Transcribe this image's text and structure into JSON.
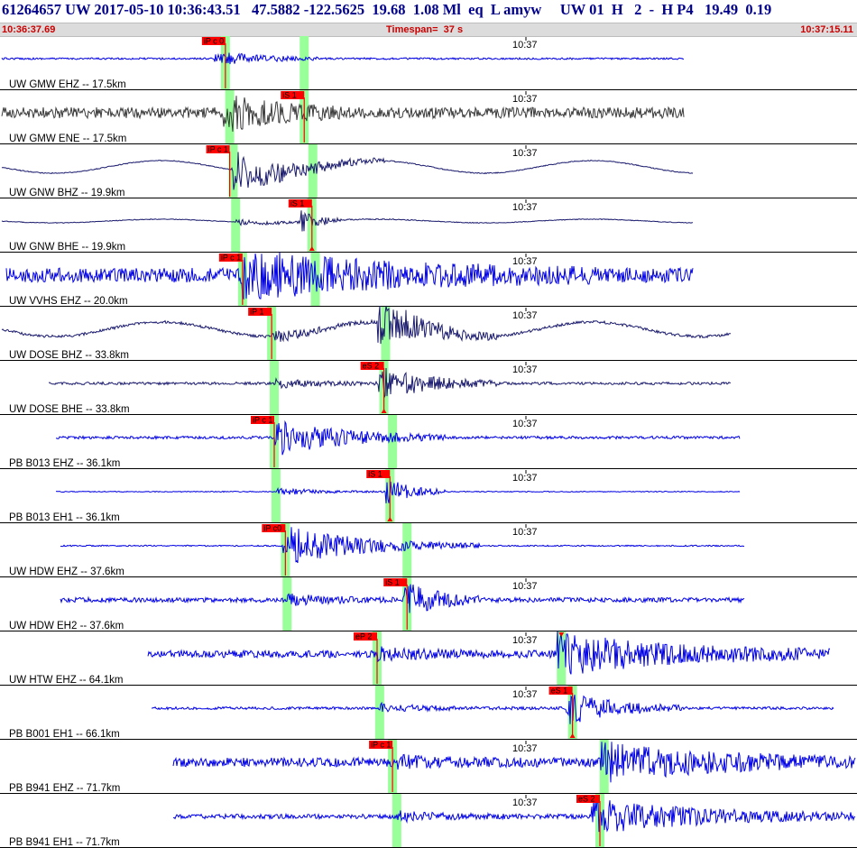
{
  "header": {
    "title": "61264657 UW 2017-05-10 10:36:43.51   47.5882 -122.5625  19.68  1.08 Ml  eq  L amyw     UW 01  H   2  -  H P4   19.49  0.19",
    "start_time": "10:36:37.69",
    "timespan": "Timespan=  37 s",
    "end_time": "10:37:15.11"
  },
  "colors": {
    "trace_blue": "#0000e6",
    "trace_navy": "#1a1a6e",
    "trace_gray": "#3a3a3a",
    "pick_box": "#ff0000",
    "pick_window": "#99ff99",
    "divider": "#000000"
  },
  "panels": [
    {
      "label": "UW GMW EHZ -- 17.5km",
      "tick": "10:37",
      "color": "trace_blue",
      "amp": 6,
      "noise": 1,
      "start": 0.0,
      "end": 0.8,
      "p": 0.263,
      "s": 0.355,
      "pick_label": "iP c 0",
      "pick_at": 0.263,
      "sig": [
        0.25,
        0.38
      ],
      "lf": 0,
      "marker": "none"
    },
    {
      "label": "UW GMW ENE -- 17.5km",
      "tick": "10:37",
      "color": "trace_gray",
      "amp": 14,
      "noise": 6,
      "start": 0.0,
      "end": 0.8,
      "p": 0.268,
      "s": 0.355,
      "pick_label": "iS 1",
      "pick_at": 0.355,
      "sig": [
        0.26,
        0.4
      ],
      "lf": 0,
      "marker": "none"
    },
    {
      "label": "UW GNW BHZ -- 19.9km",
      "tick": "10:37",
      "color": "trace_navy",
      "amp": 18,
      "noise": 0.5,
      "start": 0.0,
      "end": 0.81,
      "p": 0.272,
      "s": 0.365,
      "pick_label": "iP c 1",
      "pick_at": 0.268,
      "sig": [
        0.27,
        0.45
      ],
      "lf": 7,
      "marker": "none"
    },
    {
      "label": "UW GNW BHE -- 19.9km",
      "tick": "10:37",
      "color": "trace_navy",
      "amp": 14,
      "noise": 0.4,
      "start": 0.0,
      "end": 0.81,
      "p": 0.275,
      "s": 0.364,
      "pick_label": "iS 1",
      "pick_at": 0.364,
      "sig": [
        0.35,
        0.4
      ],
      "lf": 2,
      "marker": "s"
    },
    {
      "label": "UW VVHS EHZ -- 20.0km",
      "tick": "10:37",
      "color": "trace_blue",
      "amp": 20,
      "noise": 8,
      "start": 0.005,
      "end": 0.81,
      "p": 0.283,
      "s": 0.368,
      "pick_label": "iP c 1",
      "pick_at": 0.283,
      "sig": [
        0.28,
        0.7
      ],
      "lf": 0,
      "marker": "none"
    },
    {
      "label": "UW DOSE BHZ -- 33.8km",
      "tick": "10:37",
      "color": "trace_navy",
      "amp": 24,
      "noise": 1.5,
      "start": 0.0,
      "end": 0.855,
      "p": 0.317,
      "s": 0.45,
      "pick_label": "iP 1",
      "pick_at": 0.317,
      "sig": [
        0.44,
        0.58
      ],
      "lf": 8,
      "marker": "none"
    },
    {
      "label": "UW DOSE BHE -- 33.8km",
      "tick": "10:37",
      "color": "trace_navy",
      "amp": 18,
      "noise": 1.5,
      "start": 0.055,
      "end": 0.855,
      "p": 0.32,
      "s": 0.448,
      "pick_label": "eS 2",
      "pick_at": 0.448,
      "sig": [
        0.44,
        0.58
      ],
      "lf": 0,
      "marker": "s"
    },
    {
      "label": "PB B013 EHZ -- 36.1km",
      "tick": "10:37",
      "color": "trace_blue",
      "amp": 16,
      "noise": 1.5,
      "start": 0.063,
      "end": 0.865,
      "p": 0.32,
      "s": 0.458,
      "pick_label": "iP c 1",
      "pick_at": 0.32,
      "sig": [
        0.32,
        0.52
      ],
      "lf": 0,
      "marker": "none"
    },
    {
      "label": "PB B013 EH1 -- 36.1km",
      "tick": "10:37",
      "color": "trace_blue",
      "amp": 16,
      "noise": 0.5,
      "start": 0.063,
      "end": 0.865,
      "p": 0.322,
      "s": 0.455,
      "pick_label": "iS 1",
      "pick_at": 0.455,
      "sig": [
        0.45,
        0.52
      ],
      "lf": 0,
      "marker": "s"
    },
    {
      "label": "UW HDW EHZ -- 37.6km",
      "tick": "10:37",
      "color": "trace_blue",
      "amp": 18,
      "noise": 0.7,
      "start": 0.068,
      "end": 0.87,
      "p": 0.333,
      "s": 0.475,
      "pick_label": "iP c0",
      "pick_at": 0.333,
      "sig": [
        0.33,
        0.56
      ],
      "lf": 0,
      "marker": "none"
    },
    {
      "label": "UW HDW EH2 -- 37.6km",
      "tick": "10:37",
      "color": "trace_blue",
      "amp": 20,
      "noise": 2.5,
      "start": 0.068,
      "end": 0.87,
      "p": 0.335,
      "s": 0.475,
      "pick_label": "iS 1",
      "pick_at": 0.475,
      "sig": [
        0.47,
        0.56
      ],
      "lf": 0,
      "marker": "none"
    },
    {
      "label": "UW HTW EHZ -- 64.1km",
      "tick": "10:37",
      "color": "trace_blue",
      "amp": 22,
      "noise": 4,
      "start": 0.17,
      "end": 0.97,
      "p": 0.44,
      "s": 0.655,
      "pick_label": "eP 2",
      "pick_at": 0.44,
      "sig": [
        0.65,
        0.97
      ],
      "lf": 0,
      "marker": "top"
    },
    {
      "label": "PB B001 EH1 -- 66.1km",
      "tick": "10:37",
      "color": "trace_blue",
      "amp": 18,
      "noise": 1.5,
      "start": 0.175,
      "end": 0.975,
      "p": 0.443,
      "s": 0.668,
      "pick_label": "eS 1",
      "pick_at": 0.668,
      "sig": [
        0.66,
        0.8
      ],
      "lf": 0,
      "marker": "s"
    },
    {
      "label": "PB B941 EHZ -- 71.7km",
      "tick": "10:37",
      "color": "trace_blue",
      "amp": 20,
      "noise": 5,
      "start": 0.2,
      "end": 1.0,
      "p": 0.458,
      "s": 0.705,
      "pick_label": "iP c 1",
      "pick_at": 0.458,
      "sig": [
        0.7,
        1.0
      ],
      "lf": 0,
      "marker": "none"
    },
    {
      "label": "PB B941 EH1 -- 71.7km",
      "tick": "10:37",
      "color": "trace_blue",
      "amp": 18,
      "noise": 2.5,
      "start": 0.2,
      "end": 1.0,
      "p": 0.463,
      "s": 0.7,
      "pick_label": "eS 2",
      "pick_at": 0.7,
      "sig": [
        0.69,
        1.0
      ],
      "lf": 0,
      "marker": "none"
    }
  ]
}
